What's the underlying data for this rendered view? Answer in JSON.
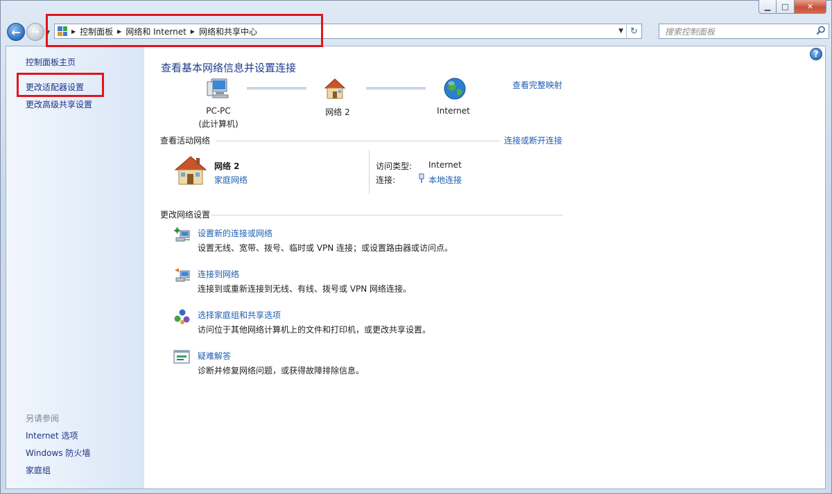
{
  "window": {
    "caption_min": "▁",
    "caption_max": "□",
    "caption_close": "✕"
  },
  "nav": {
    "back_glyph": "←",
    "forward_glyph": "→",
    "breadcrumb": [
      "控制面板",
      "网络和 Internet",
      "网络和共享中心"
    ],
    "refresh_glyph": "↻",
    "search_placeholder": "搜索控制面板"
  },
  "sidebar": {
    "home": "控制面板主页",
    "items": [
      "更改适配器设置",
      "更改高级共享设置"
    ],
    "see_also_heading": "另请参阅",
    "see_also": [
      "Internet 选项",
      "Windows 防火墙",
      "家庭组"
    ]
  },
  "main": {
    "title": "查看基本网络信息并设置连接",
    "view_full_map": "查看完整映射",
    "map": {
      "pc_name": "PC-PC",
      "pc_note": "(此计算机)",
      "network_name": "网络  2",
      "internet": "Internet"
    },
    "active_networks": {
      "heading": "查看活动网络",
      "connect_link": "连接或断开连接",
      "network_name": "网络  2",
      "network_type": "家庭网络",
      "access_label": "访问类型:",
      "access_value": "Internet",
      "conn_label": "连接:",
      "conn_value": "本地连接"
    },
    "change_settings": {
      "heading": "更改网络设置",
      "tasks": [
        {
          "title": "设置新的连接或网络",
          "desc": "设置无线、宽带、拨号、临时或 VPN 连接；或设置路由器或访问点。"
        },
        {
          "title": "连接到网络",
          "desc": "连接到或重新连接到无线、有线、拨号或 VPN 网络连接。"
        },
        {
          "title": "选择家庭组和共享选项",
          "desc": "访问位于其他网络计算机上的文件和打印机，或更改共享设置。"
        },
        {
          "title": "疑难解答",
          "desc": "诊断并修复网络问题，或获得故障排除信息。"
        }
      ]
    },
    "help_glyph": "?"
  },
  "colors": {
    "link": "#1e5eb0",
    "title": "#1e3c8c",
    "highlight": "#e0151b"
  }
}
